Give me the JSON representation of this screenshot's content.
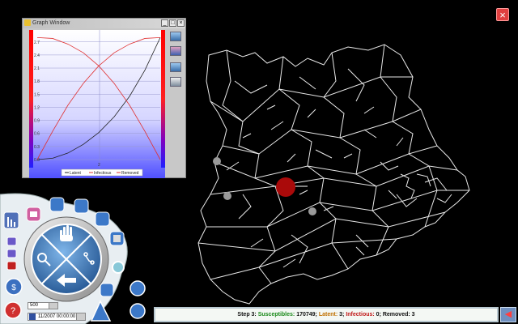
{
  "graph_window": {
    "title": "Graph Window",
    "min_label": "_",
    "max_label": "□",
    "close_label": "×",
    "y_ticks": [
      "2.7",
      "2.4",
      "2.1",
      "1.8",
      "1.5",
      "1.2",
      "0.9",
      "0.6",
      "0.3",
      "0.0"
    ],
    "x_tick": "2",
    "legend": [
      "Latent",
      "Infectious",
      "Removed"
    ]
  },
  "chart_data": {
    "type": "line",
    "ylim": [
      0,
      2.9
    ],
    "xlim": [
      0,
      4
    ],
    "series": [
      {
        "name": "Latent",
        "color": "#222222",
        "x": [
          0,
          0.5,
          1,
          1.5,
          2,
          2.5,
          3,
          3.5,
          4
        ],
        "y": [
          0,
          0.03,
          0.15,
          0.35,
          0.62,
          0.98,
          1.45,
          2.05,
          2.8
        ]
      },
      {
        "name": "Infectious",
        "color": "#e03030",
        "x": [
          0,
          0.5,
          1,
          1.5,
          2,
          2.5,
          3,
          3.5,
          4
        ],
        "y": [
          2.8,
          2.78,
          2.65,
          2.45,
          2.15,
          1.75,
          1.25,
          0.65,
          0.0
        ]
      },
      {
        "name": "Removed",
        "color": "#e03030",
        "x": [
          0,
          0.5,
          1,
          1.5,
          2,
          2.5,
          3,
          3.5,
          4
        ],
        "y": [
          0.0,
          0.65,
          1.25,
          1.75,
          2.15,
          2.45,
          2.65,
          2.78,
          2.8
        ]
      }
    ]
  },
  "map": {
    "infection_color": "#aa0a0a",
    "marker_color": "#9a9a9a"
  },
  "status": {
    "prefix": "Step 3:",
    "susceptibles_label": "Susceptibles:",
    "susceptibles_value": "170749;",
    "latent_label": "Latent:",
    "latent_value": "3;",
    "infectious_label": "Infectious:",
    "infectious_value": "0;",
    "removed_label": "Removed:",
    "removed_value": "3"
  },
  "controls": {
    "speed_value": "500",
    "date_value": "11/2007 00:00:00",
    "close_icon": "close-icon",
    "help_label": "?",
    "money_label": "$"
  }
}
